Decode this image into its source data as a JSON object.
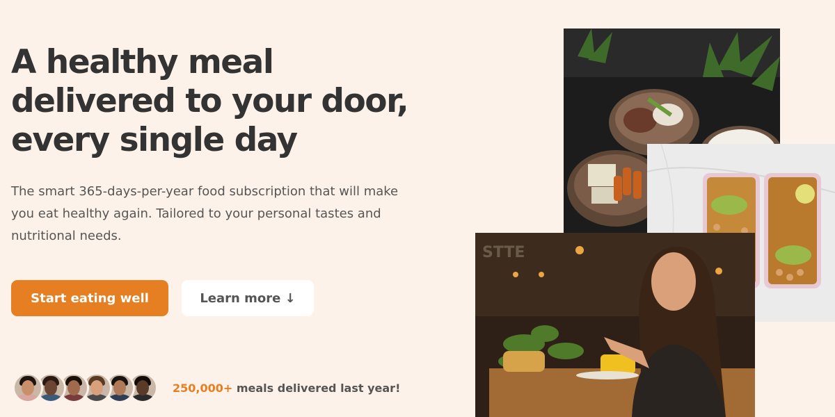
{
  "hero": {
    "title": "A healthy meal\ndelivered to your door,\nevery single day",
    "description": "The smart 365-days-per-year food subscription that will make you eat healthy again. Tailored to your personal tastes and nutritional needs."
  },
  "buttons": {
    "primary_label": "Start eating well",
    "secondary_label": "Learn more ↓"
  },
  "delivered": {
    "count": "250,000+",
    "text": " meals delivered last year!",
    "avatars": [
      {
        "skin": "#c98f6b",
        "hair": "#1e1410",
        "shirt": "#d9a6a0"
      },
      {
        "skin": "#6b4632",
        "hair": "#2a1a12",
        "shirt": "#3c5a7a"
      },
      {
        "skin": "#a06a4c",
        "hair": "#1a100a",
        "shirt": "#7a3b3b"
      },
      {
        "skin": "#d8a07c",
        "hair": "#5a3a22",
        "shirt": "#4a4a4a"
      },
      {
        "skin": "#b07a58",
        "hair": "#1a1410",
        "shirt": "#2f3e55"
      },
      {
        "skin": "#5a3a28",
        "hair": "#140c08",
        "shirt": "#2a2a2a"
      }
    ]
  },
  "colors": {
    "background": "#fdf2e9",
    "accent": "#e67e22",
    "heading": "#333333",
    "body": "#555555"
  }
}
